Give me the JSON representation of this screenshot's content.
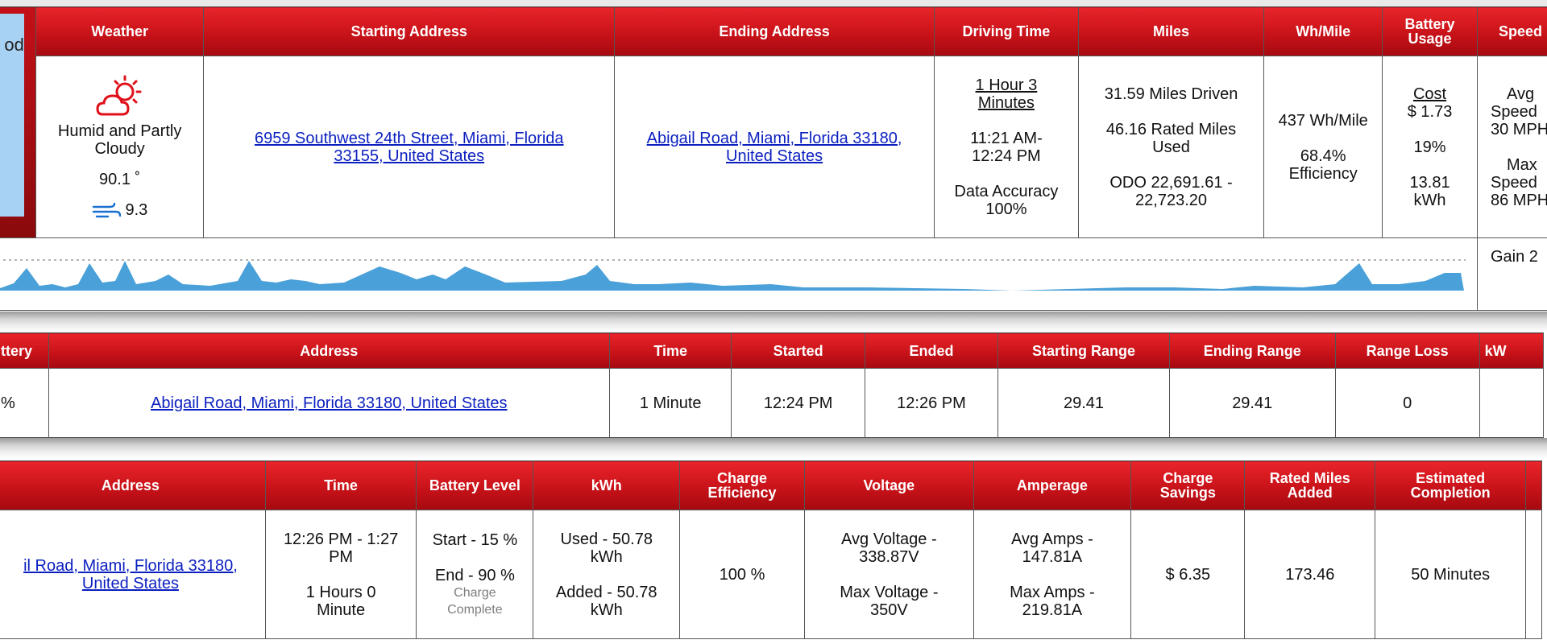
{
  "drive": {
    "lead_text": "od",
    "headers": {
      "weather": "Weather",
      "starting_address": "Starting Address",
      "ending_address": "Ending Address",
      "driving_time": "Driving Time",
      "miles": "Miles",
      "wh_mile": "Wh/Mile",
      "battery_usage_1": "Battery",
      "battery_usage_2": "Usage",
      "speed": "Speed"
    },
    "weather": {
      "icon": "partly-cloudy-sun-icon",
      "condition_1": "Humid and Partly",
      "condition_2": "Cloudy",
      "temperature": "90.1 ˚",
      "wind_icon": "wind-icon",
      "wind": "9.3"
    },
    "starting_address": {
      "line1": "6959 Southwest 24th Street, Miami, Florida",
      "line2": "33155, United States"
    },
    "ending_address": {
      "line1": "Abigail Road, Miami, Florida 33180,",
      "line2": "United States"
    },
    "driving_time": {
      "duration_1": "1 Hour 3",
      "duration_2": "Minutes",
      "range_1": "11:21 AM-",
      "range_2": "12:24 PM",
      "accuracy_1": "Data Accuracy",
      "accuracy_2": "100%"
    },
    "miles": {
      "driven": "31.59 Miles Driven",
      "rated_1": "46.16 Rated Miles",
      "rated_2": "Used",
      "odo_1": "ODO 22,691.61 -",
      "odo_2": "22,723.20"
    },
    "wh_mile": {
      "value": "437 Wh/Mile",
      "efficiency_1": "68.4%",
      "efficiency_2": "Efficiency"
    },
    "battery_usage": {
      "cost_label": "Cost",
      "cost": "$ 1.73",
      "percent": "19%",
      "kwh_1": "13.81",
      "kwh_2": "kWh"
    },
    "speed": {
      "avg_1": "Avg",
      "avg_2": "Speed",
      "avg_3": "30 MPH",
      "max_1": "Max",
      "max_2": "Speed",
      "max_3": "86 MPH"
    },
    "elevation": {
      "gain": "Gain 2"
    }
  },
  "parked": {
    "headers": {
      "battery": "ttery",
      "address": "Address",
      "time": "Time",
      "started": "Started",
      "ended": "Ended",
      "starting_range": "Starting Range",
      "ending_range": "Ending Range",
      "range_loss": "Range Loss",
      "kw": "kW"
    },
    "row": {
      "battery": "%",
      "address": "Abigail Road, Miami, Florida 33180, United States",
      "time": "1 Minute",
      "started": "12:24 PM",
      "ended": "12:26 PM",
      "starting_range": "29.41",
      "ending_range": "29.41",
      "range_loss": "0",
      "kw": ""
    }
  },
  "charge": {
    "headers": {
      "address": "Address",
      "time": "Time",
      "battery_level": "Battery Level",
      "kwh": "kWh",
      "charge_efficiency_1": "Charge",
      "charge_efficiency_2": "Efficiency",
      "voltage": "Voltage",
      "amperage": "Amperage",
      "charge_savings_1": "Charge",
      "charge_savings_2": "Savings",
      "rated_miles_added_1": "Rated Miles",
      "rated_miles_added_2": "Added",
      "estimated_completion_1": "Estimated",
      "estimated_completion_2": "Completion"
    },
    "row": {
      "address_1": "il Road, Miami, Florida 33180,",
      "address_2": "United States",
      "time_1": "12:26 PM - 1:27",
      "time_2": "PM",
      "time_3": "1 Hours 0",
      "time_4": "Minute",
      "battery_start": "Start - 15 %",
      "battery_end": "End - 90 %",
      "battery_status_1": "Charge",
      "battery_status_2": "Complete",
      "kwh_used_1": "Used - 50.78",
      "kwh_used_2": "kWh",
      "kwh_added_1": "Added - 50.78",
      "kwh_added_2": "kWh",
      "charge_efficiency": "100 %",
      "voltage_avg_1": "Avg Voltage -",
      "voltage_avg_2": "338.87V",
      "voltage_max_1": "Max Voltage -",
      "voltage_max_2": "350V",
      "amps_avg_1": "Avg Amps -",
      "amps_avg_2": "147.81A",
      "amps_max_1": "Max Amps -",
      "amps_max_2": "219.81A",
      "charge_savings": "$ 6.35",
      "rated_miles_added": "173.46",
      "estimated_completion": "50 Minutes"
    }
  },
  "colors": {
    "header_red": "#c81219",
    "link_blue": "#0b1fbf",
    "graph_fill": "#4aa0d8",
    "panel_blue": "#a8d2f3"
  }
}
